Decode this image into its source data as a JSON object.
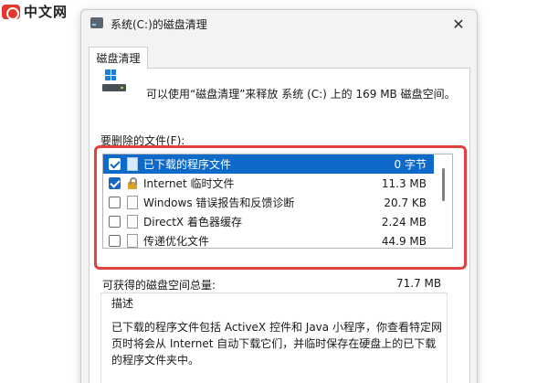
{
  "watermark": {
    "text": "中文网"
  },
  "window": {
    "title": "系统(C:)的磁盘清理",
    "close_glyph": "✕",
    "tab_label": "磁盘清理"
  },
  "intro_text": "可以使用“磁盘清理”来释放 系统 (C:) 上的 169 MB 磁盘空间。",
  "files_label": "要删除的文件(F):",
  "files": [
    {
      "name": "已下载的程序文件",
      "size": "0 字节",
      "checked": true,
      "selected": true,
      "icon": "folder-file-icon"
    },
    {
      "name": "Internet 临时文件",
      "size": "11.3 MB",
      "checked": true,
      "selected": false,
      "icon": "lock-icon"
    },
    {
      "name": "Windows 错误报告和反馈诊断",
      "size": "20.7 KB",
      "checked": false,
      "selected": false,
      "icon": "file-icon"
    },
    {
      "name": "DirectX 着色器缓存",
      "size": "2.24 MB",
      "checked": false,
      "selected": false,
      "icon": "file-icon"
    },
    {
      "name": "传递优化文件",
      "size": "44.9 MB",
      "checked": false,
      "selected": false,
      "icon": "file-icon"
    }
  ],
  "total": {
    "label": "可获得的磁盘空间总量:",
    "value": "71.7 MB"
  },
  "description": {
    "label": "描述",
    "text": "已下载的程序文件包括 ActiveX 控件和 Java 小程序，你查看特定网页时将会从 Internet 自动下载它们，并临时保存在硬盘上的已下载的程序文件夹中。"
  },
  "colors": {
    "highlight": "#e2403d",
    "selection": "#0e6ac8"
  }
}
